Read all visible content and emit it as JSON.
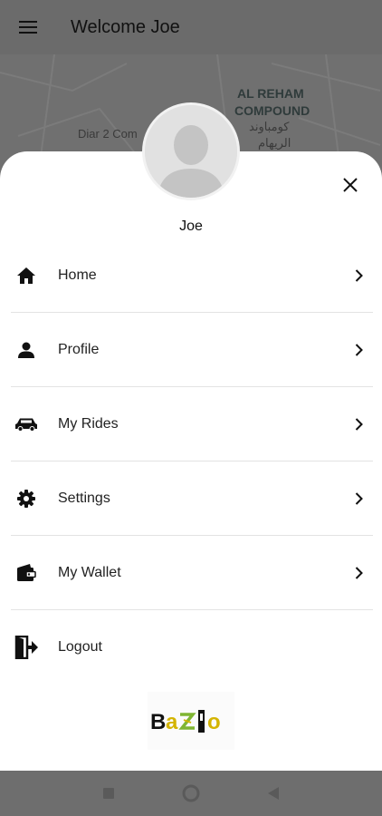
{
  "appbar": {
    "title": "Welcome Joe",
    "menu_icon": "hamburger-menu-icon"
  },
  "map": {
    "labels": [
      "Diar 2 Com",
      "AL REHAM",
      "COMPOUND",
      "كومباوند",
      "الريهام"
    ]
  },
  "drawer": {
    "user_name": "Joe",
    "close_icon": "close-icon",
    "items": [
      {
        "label": "Home",
        "icon": "home-icon"
      },
      {
        "label": "Profile",
        "icon": "person-icon"
      },
      {
        "label": "My Rides",
        "icon": "car-icon"
      },
      {
        "label": "Settings",
        "icon": "gear-icon"
      },
      {
        "label": "My Wallet",
        "icon": "wallet-icon"
      },
      {
        "label": "Logout",
        "icon": "logout-icon"
      }
    ],
    "brand_logo_text": "Bazio"
  },
  "colors": {
    "scrim": "#6f6f6f",
    "sheet": "#ffffff",
    "brand_yellow": "#d4b400",
    "brand_green": "#7fb532"
  }
}
